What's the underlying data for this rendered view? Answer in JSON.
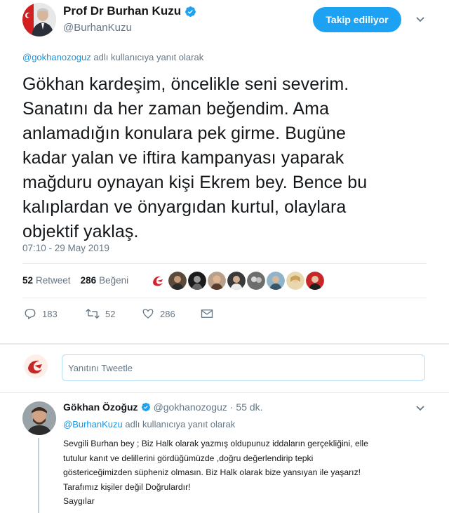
{
  "header": {
    "author_name": "Prof Dr Burhan Kuzu",
    "author_handle": "@BurhanKuzu",
    "follow_label": "Takip ediliyor"
  },
  "tweet": {
    "reply_to_handle": "@gokhanozoguz",
    "reply_to_suffix": "adlı kullanıcıya yanıt olarak",
    "lines": [
      "Gökhan kardeşim, öncelikle seni severim.",
      "Sanatını da her zaman beğendim. Ama",
      "anlamadığın konulara pek girme. Bugüne",
      "kadar yalan ve iftira kampanyası yaparak",
      "mağduru oynayan kişi Ekrem bey. Bence bu",
      "kalıplardan ve önyargıdan kurtul, olaylara",
      "objektif yaklaş."
    ],
    "timestamp": "07:10 - 29 May 2019"
  },
  "stats": {
    "retweet_count": "52",
    "retweet_label": "Retweet",
    "like_count": "286",
    "like_label": "Beğeni"
  },
  "actions": {
    "reply_count": "183",
    "retweet_count": "52",
    "like_count": "286"
  },
  "reply_box": {
    "placeholder": "Yanıtını Tweetle"
  },
  "reply": {
    "author_name": "Gökhan Özoğuz",
    "author_handle": "@gokhanozoguz",
    "time": "· 55 dk.",
    "reply_to_handle": "@BurhanKuzu",
    "reply_to_suffix": "adlı kullanıcıya yanıt olarak",
    "lines": [
      "Sevgili Burhan bey ; Biz Halk olarak yazmış oldupunuz iddaların gerçekliğini, elle",
      "tutulur kanıt ve delillerini gördüğümüzde ,doğru değerlendirip tepki",
      "göstericeğimizden süpheniz olmasın. Biz Halk olarak bize yansıyan ile yaşarız!",
      "Tarafımız kişiler değil Doğrulardır!",
      "Saygılar"
    ]
  },
  "colors": {
    "accent": "#1da1f2",
    "link": "#1b95e0",
    "muted": "#657786",
    "text": "#14171a"
  }
}
